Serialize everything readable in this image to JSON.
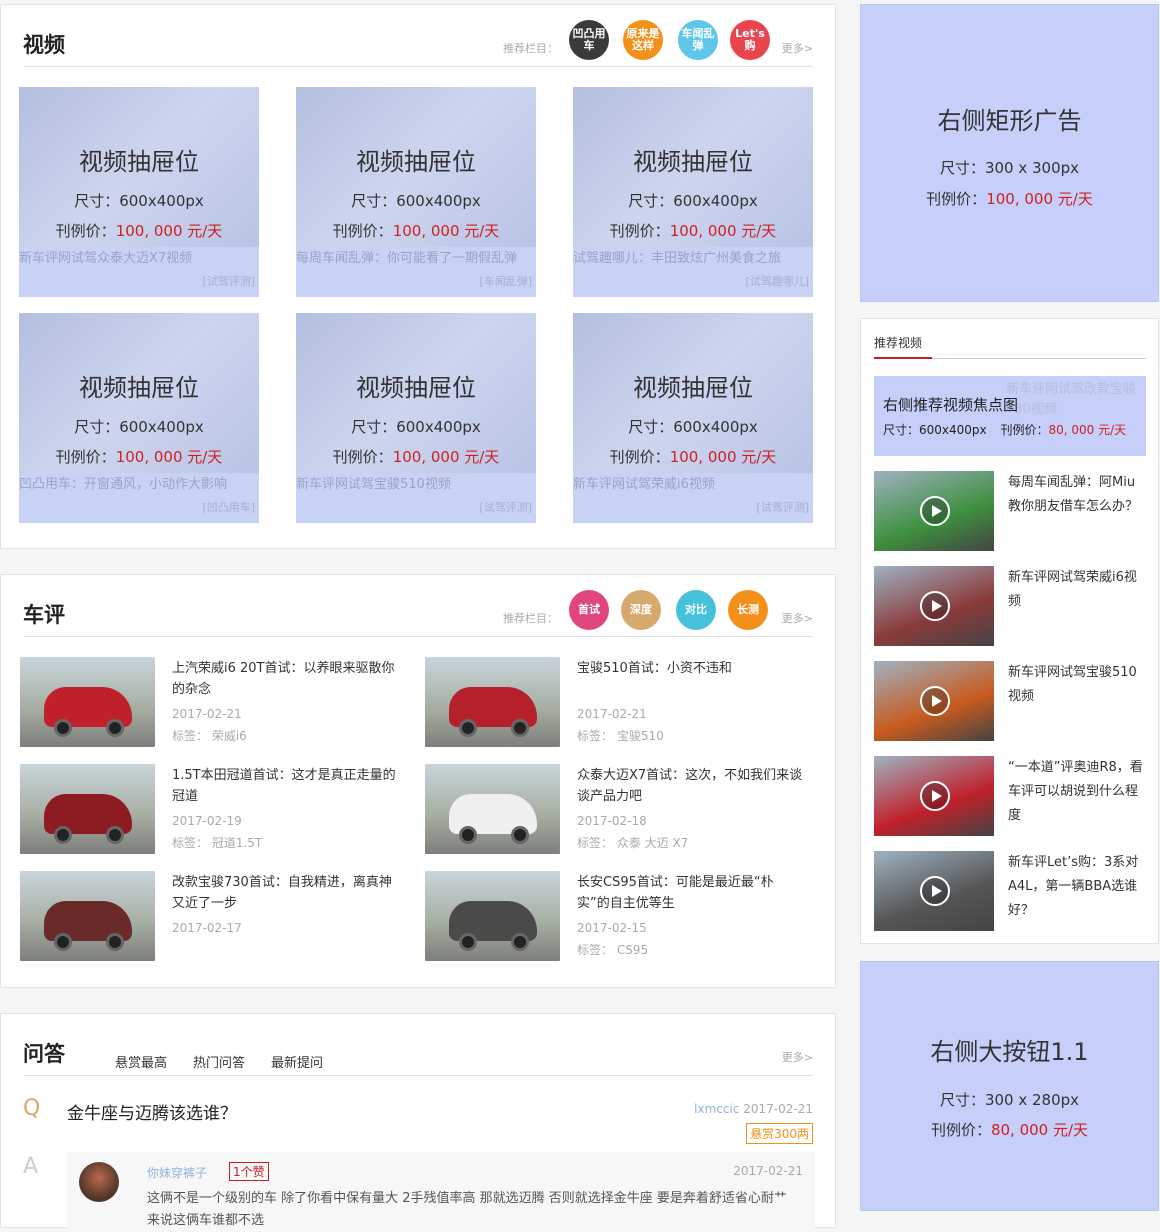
{
  "video": {
    "title": "视频",
    "rec_label": "推荐栏目：",
    "more": "更多>",
    "channels": [
      {
        "label": "凹凸用车",
        "color": "#3a3a3a"
      },
      {
        "label": "原来是这样",
        "color": "#f39019"
      },
      {
        "label": "车闻乱弹",
        "color": "#5ec6e8"
      },
      {
        "label": "Let's购",
        "color": "#e8454f"
      }
    ],
    "cards": [
      {
        "ad_title": "视频抽屉位",
        "ad_size": "尺寸：600x400px",
        "price_label": "刊例价：",
        "price": "100, 000 元/天",
        "caption": "新车评网试驾众泰大迈X7视频",
        "src": "[试驾评测]"
      },
      {
        "ad_title": "视频抽屉位",
        "ad_size": "尺寸：600x400px",
        "price_label": "刊例价：",
        "price": "100, 000 元/天",
        "caption": "每周车闻乱弹：你可能看了一期假乱弹",
        "src": "[车闻乱弹]"
      },
      {
        "ad_title": "视频抽屉位",
        "ad_size": "尺寸：600x400px",
        "price_label": "刊例价：",
        "price": "100, 000 元/天",
        "caption": "试驾趣哪儿：丰田致炫广州美食之旅",
        "src": "[试驾趣哪儿]"
      },
      {
        "ad_title": "视频抽屉位",
        "ad_size": "尺寸：600x400px",
        "price_label": "刊例价：",
        "price": "100, 000 元/天",
        "caption": "凹凸用车：开窗通风，小动作大影响",
        "src": "[凹凸用车]"
      },
      {
        "ad_title": "视频抽屉位",
        "ad_size": "尺寸：600x400px",
        "price_label": "刊例价：",
        "price": "100, 000 元/天",
        "caption": "新车评网试驾宝骏510视频",
        "src": "[试驾评测]"
      },
      {
        "ad_title": "视频抽屉位",
        "ad_size": "尺寸：600x400px",
        "price_label": "刊例价：",
        "price": "100, 000 元/天",
        "caption": "新车评网试驾荣威i6视频",
        "src": "[试驾评测]"
      }
    ]
  },
  "review": {
    "title": "车评",
    "rec_label": "推荐栏目：",
    "more": "更多>",
    "channels": [
      {
        "label": "首试",
        "color": "#e0457e"
      },
      {
        "label": "深度",
        "color": "#d6aa6c"
      },
      {
        "label": "对比",
        "color": "#45c1db"
      },
      {
        "label": "长测",
        "color": "#f39019"
      }
    ],
    "items": [
      {
        "title": "上汽荣威i6 20T首试：以养眼来驱散你的杂念",
        "date": "2017-02-21",
        "tag": "标签： 荣威i6",
        "color": "#c0202a"
      },
      {
        "title": "宝骏510首试：小资不违和",
        "date": "2017-02-21",
        "tag": "标签： 宝骏510",
        "color": "#b5202a"
      },
      {
        "title": "1.5T本田冠道首试：这才是真正走量的冠道",
        "date": "2017-02-19",
        "tag": "标签： 冠道1.5T",
        "color": "#8c1c22"
      },
      {
        "title": "众泰大迈X7首试：这次，不如我们来谈谈产品力吧",
        "date": "2017-02-18",
        "tag": "标签： 众泰 大迈 X7",
        "color": "#f0f0f0"
      },
      {
        "title": "改款宝骏730首试：自我精进，离真神又近了一步",
        "date": "2017-02-17",
        "tag": "",
        "color": "#6b2a2a"
      },
      {
        "title": "长安CS95首试：可能是最近最“朴实”的自主优等生",
        "date": "2017-02-15",
        "tag": "标签： CS95",
        "color": "#4a4a48"
      }
    ]
  },
  "qa": {
    "title": "问答",
    "tabs": [
      "悬赏最高",
      "热门问答",
      "最新提问"
    ],
    "more": "更多>",
    "q_mark": "Q",
    "question": "金牛座与迈腾该选谁？",
    "asker": "lxmccic",
    "ask_date": "2017-02-21",
    "reward": "悬赏300两",
    "a_mark": "A",
    "answerer": "你妹穿裤子",
    "likes": "1个赞",
    "answer_date": "2017-02-21",
    "answer": "这俩不是一个级别的车  除了你看中保有量大 2手残值率高 那就选迈腾 否则就选择金牛座    要是奔着舒适省心耐艹来说这俩车谁都不选"
  },
  "right_ad1": {
    "title": "右侧矩形广告",
    "size": "尺寸：300 x 300px",
    "price_label": "刊例价：",
    "price": "100, 000 元/天"
  },
  "rec_videos": {
    "title": "推荐视频",
    "focus": {
      "title": "右侧推荐视频焦点图",
      "size": "尺寸：600x400px",
      "price_label": "刊例价：",
      "price": "80, 000 元/天",
      "bg_text": "新车评网试驾改款宝骏730视频"
    },
    "items": [
      {
        "title": "每周车闻乱弹：阿Miu教你朋友借车怎么办？",
        "color": "#3e8f3e"
      },
      {
        "title": "新车评网试驾荣威i6视频",
        "color": "#8a3a3a"
      },
      {
        "title": "新车评网试驾宝骏510视频",
        "color": "#c85a1e"
      },
      {
        "title": "“一本道”评奥迪R8，看车评可以胡说到什么程度",
        "color": "#c0202a"
      },
      {
        "title": "新车评Let’s购：3系对A4L，第一辆BBA选谁好？",
        "color": "#555555"
      }
    ]
  },
  "right_ad2": {
    "title": "右侧大按钮1.1",
    "size": "尺寸：300 x 280px",
    "price_label": "刊例价：",
    "price": "80, 000 元/天"
  }
}
